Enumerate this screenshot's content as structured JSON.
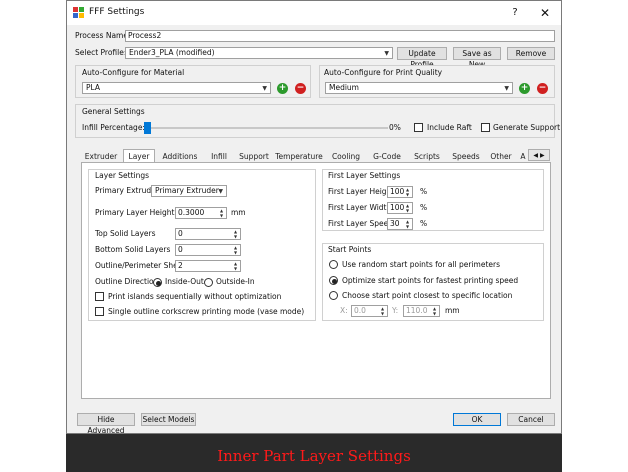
{
  "window": {
    "title": "FFF Settings",
    "help": "?",
    "close": "✕"
  },
  "process": {
    "name_label": "Process Name:",
    "name_value": "Process2"
  },
  "profile": {
    "label": "Select Profile:",
    "value": "Ender3_PLA (modified)",
    "update": "Update Profile",
    "save_as_new": "Save as New",
    "remove": "Remove"
  },
  "material": {
    "group_title": "Auto-Configure for Material",
    "value": "PLA"
  },
  "quality": {
    "group_title": "Auto-Configure for Print Quality",
    "value": "Medium"
  },
  "general": {
    "group_title": "General Settings",
    "infill_label": "Infill Percentage:",
    "infill_value": "0%",
    "infill_fraction": 0,
    "include_raft": "Include Raft",
    "generate_support": "Generate Support"
  },
  "tabs": [
    "Extruder",
    "Layer",
    "Additions",
    "Infill",
    "Support",
    "Temperature",
    "Cooling",
    "G-Code",
    "Scripts",
    "Speeds",
    "Other",
    "A"
  ],
  "active_tab": "Layer",
  "layer_settings": {
    "title": "Layer Settings",
    "primary_extruder_label": "Primary Extruder",
    "primary_extruder_value": "Primary Extruder",
    "primary_layer_height_label": "Primary Layer Height",
    "primary_layer_height_value": "0.3000",
    "primary_layer_height_unit": "mm",
    "top_solid_label": "Top Solid Layers",
    "top_solid_value": "0",
    "bottom_solid_label": "Bottom Solid Layers",
    "bottom_solid_value": "0",
    "shells_label": "Outline/Perimeter Shells",
    "shells_value": "2",
    "outline_direction_label": "Outline Direction:",
    "inside_out": "Inside-Out",
    "outside_in": "Outside-In",
    "print_islands": "Print islands sequentially without optimization",
    "single_outline": "Single outline corkscrew printing mode (vase mode)"
  },
  "first_layer": {
    "title": "First Layer Settings",
    "height_label": "First Layer Height",
    "height_value": "100",
    "height_unit": "%",
    "width_label": "First Layer Width",
    "width_value": "100",
    "width_unit": "%",
    "speed_label": "First Layer Speed",
    "speed_value": "30",
    "speed_unit": "%"
  },
  "start_points": {
    "title": "Start Points",
    "opt_random": "Use random start points for all perimeters",
    "opt_optimize": "Optimize start points for fastest printing speed",
    "opt_closest": "Choose start point closest to specific location",
    "x_label": "X:",
    "x_value": "0.0",
    "y_label": "Y:",
    "y_value": "110.0",
    "unit": "mm"
  },
  "footer": {
    "hide_advanced": "Hide Advanced",
    "select_models": "Select Models",
    "ok": "OK",
    "cancel": "Cancel"
  },
  "caption": "Inner Part Layer Settings",
  "colors": {
    "accent": "#0078d7",
    "plus": "#2c9a2c",
    "minus": "#d02020",
    "caption": "#ff1a1a"
  }
}
